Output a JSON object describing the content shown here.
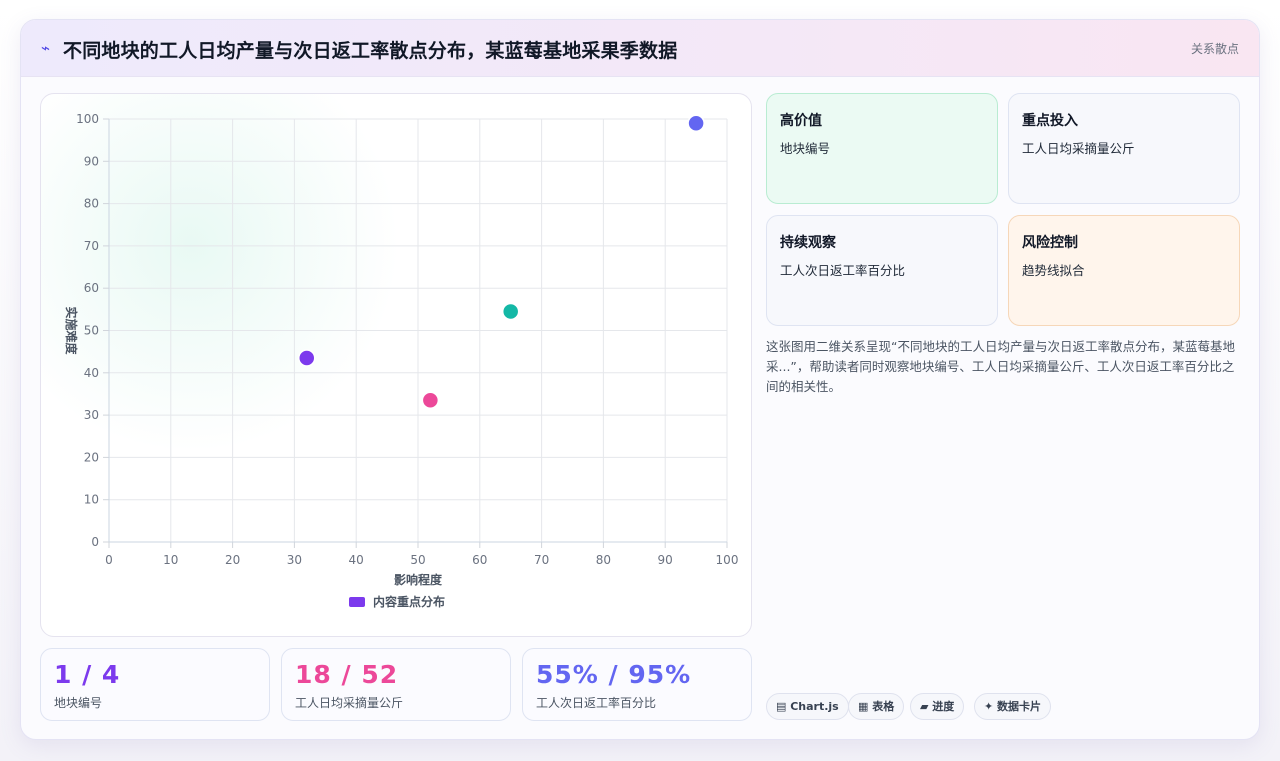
{
  "header": {
    "icon": "⌁",
    "title": "不同地块的工人日均产量与次日返工率散点分布，某蓝莓基地采果季数据",
    "tag": "关系散点"
  },
  "chart_data": {
    "type": "scatter",
    "xlabel": "影响程度",
    "ylabel": "实施难度",
    "xlim": [
      0,
      100
    ],
    "ylim": [
      0,
      100
    ],
    "xticks": [
      "0",
      "10",
      "20",
      "30",
      "40",
      "50",
      "60",
      "70",
      "80",
      "90",
      "100"
    ],
    "yticks": [
      "0",
      "10",
      "20",
      "30",
      "40",
      "50",
      "60",
      "70",
      "80",
      "90",
      "100"
    ],
    "grid": true,
    "legend_position": "bottom",
    "series": [
      {
        "name": "内容重点分布",
        "legend_color": "#7c3aed",
        "points": [
          {
            "x": 32,
            "y": 43.5,
            "color": "#7c3aed"
          },
          {
            "x": 52,
            "y": 33.5,
            "color": "#ec4899"
          },
          {
            "x": 65,
            "y": 54.5,
            "color": "#14b8a6"
          },
          {
            "x": 95,
            "y": 99,
            "color": "#6366f1"
          }
        ]
      }
    ]
  },
  "stats": [
    {
      "value": "1 / 4",
      "label": "地块编号",
      "color": "#7c3aed"
    },
    {
      "value": "18 / 52",
      "label": "工人日均采摘量公斤",
      "color": "#ec4899"
    },
    {
      "value": "55% / 95%",
      "label": "工人次日返工率百分比",
      "color": "#6366f1"
    }
  ],
  "cards": [
    {
      "title": "高价值",
      "sub": "地块编号"
    },
    {
      "title": "重点投入",
      "sub": "工人日均采摘量公斤"
    },
    {
      "title": "持续观察",
      "sub": "工人次日返工率百分比"
    },
    {
      "title": "风险控制",
      "sub": "趋势线拟合"
    }
  ],
  "description": "这张图用二维关系呈现“不同地块的工人日均产量与次日返工率散点分布，某蓝莓基地采...”，帮助读者同时观察地块编号、工人日均采摘量公斤、工人次日返工率百分比之间的相关性。",
  "chips": [
    "▤ Chart.js",
    "▦ 表格",
    "▰ 进度",
    "✦ 数据卡片"
  ]
}
